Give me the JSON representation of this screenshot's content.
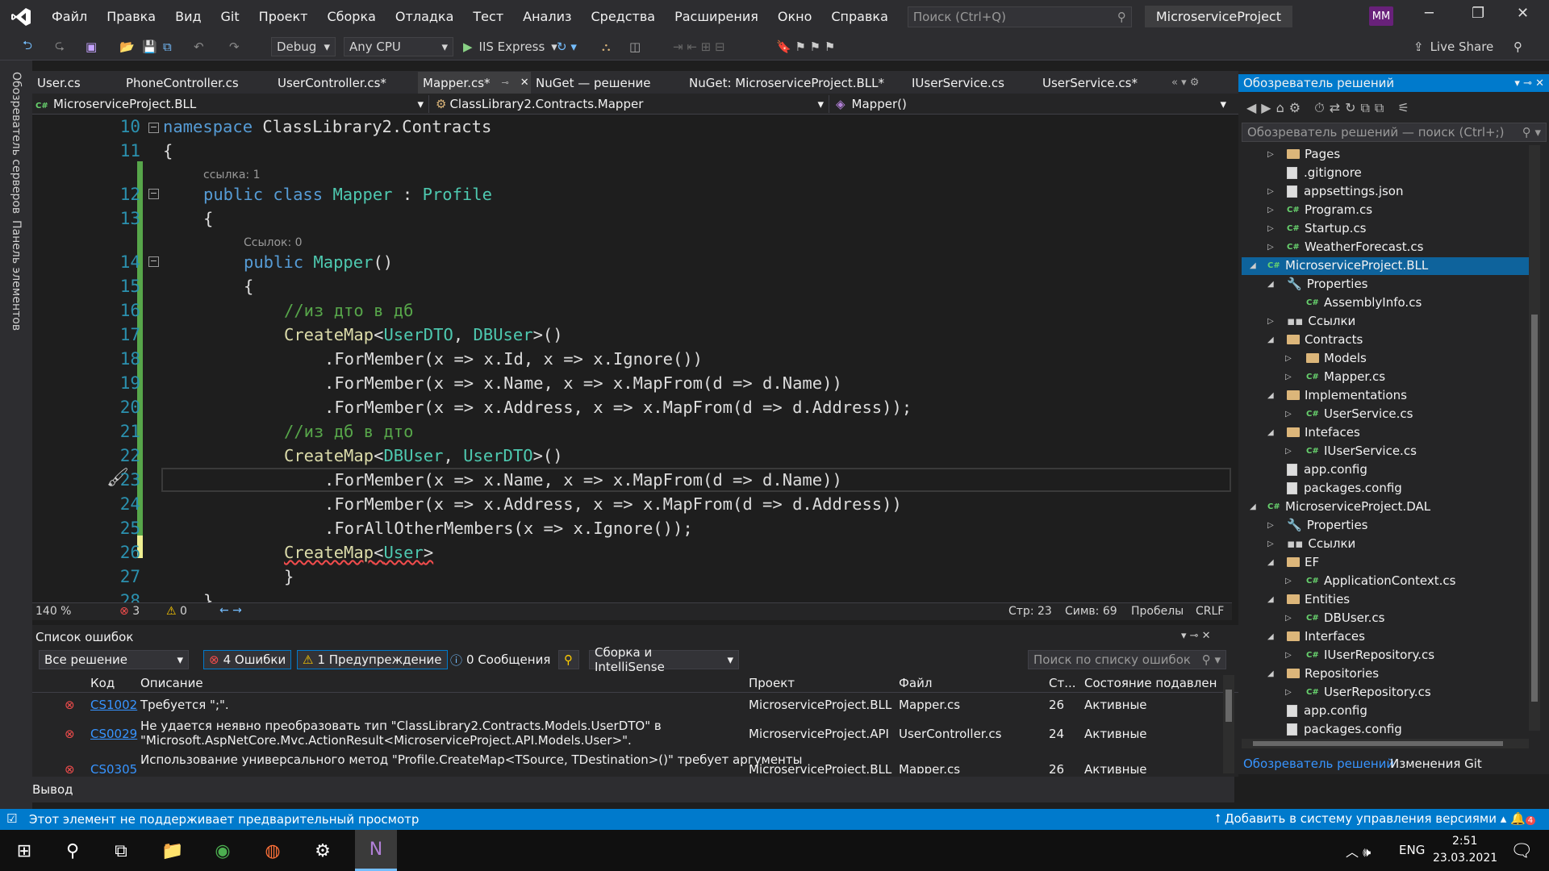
{
  "menubar": {
    "items": [
      "Файл",
      "Правка",
      "Вид",
      "Git",
      "Проект",
      "Сборка",
      "Отладка",
      "Тест",
      "Анализ",
      "Средства",
      "Расширения",
      "Окно",
      "Справка"
    ],
    "search_placeholder": "Поиск (Ctrl+Q)",
    "project": "MicroserviceProject",
    "avatar": "MM"
  },
  "toolbar": {
    "config": "Debug",
    "platform": "Any CPU",
    "run": "IIS Express",
    "live_share": "Live Share"
  },
  "leftstrip": {
    "servers": "Обозреватель серверов",
    "toolbox": "Панель элементов"
  },
  "tabs": [
    "User.cs",
    "PhoneController.cs",
    "UserController.cs*",
    "Mapper.cs*",
    "NuGet — решение",
    "NuGet: MicroserviceProject.BLL*",
    "IUserService.cs",
    "UserService.cs*"
  ],
  "navbar": {
    "project": "MicroserviceProject.BLL",
    "class": "ClassLibrary2.Contracts.Mapper",
    "member": "Mapper()"
  },
  "code": {
    "l10": {
      "n": "10",
      "kw": "namespace",
      "rest": " ClassLibrary2.Contracts"
    },
    "l11": {
      "n": "11",
      "t": "{"
    },
    "ref1": "ссылка: 1",
    "l12": {
      "n": "12",
      "a": "public",
      "b": "class",
      "c": "Mapper",
      "d": " : ",
      "e": "Profile"
    },
    "l13": {
      "n": "13",
      "t": "{"
    },
    "ref2": "Ссылок: 0",
    "l14": {
      "n": "14",
      "a": "public",
      "c": "Mapper",
      "d": "()"
    },
    "l15": {
      "n": "15",
      "t": "{"
    },
    "l16": {
      "n": "16",
      "t": "//из дто в дб"
    },
    "l17": {
      "n": "17",
      "m": "CreateMap",
      "a": "<",
      "b": "UserDTO",
      ",": ", ",
      "c": "DBUser",
      "d": ">()"
    },
    "l18": {
      "n": "18",
      "t": ".ForMember(x => x.Id, x => x.Ignore())"
    },
    "l19": {
      "n": "19",
      "t": ".ForMember(x => x.Name, x => x.MapFrom(d => d.Name))"
    },
    "l20": {
      "n": "20",
      "t": ".ForMember(x => x.Address, x => x.MapFrom(d => d.Address));"
    },
    "l21": {
      "n": "21",
      "t": "//из дб в дто"
    },
    "l22": {
      "n": "22",
      "m": "CreateMap",
      "a": "<",
      "b": "DBUser",
      "sep": ", ",
      "c": "UserDTO",
      "d": ">()"
    },
    "l23": {
      "n": "23",
      "t": ".ForMember(x => x.Name, x => x.MapFrom(d => d.Name))"
    },
    "l24": {
      "n": "24",
      "t": ".ForMember(x => x.Address, x => x.MapFrom(d => d.Address))"
    },
    "l25": {
      "n": "25",
      "t": ".ForAllOtherMembers(x => x.Ignore());"
    },
    "l26": {
      "n": "26",
      "m": "CreateMap",
      "a": "<",
      "b": "User",
      "d": ">"
    },
    "l27": {
      "n": "27",
      "t": "}"
    },
    "l28": {
      "n": "28",
      "t": "}"
    }
  },
  "edstatus": {
    "zoom": "140 %",
    "errors": "3",
    "warnings": "0",
    "line": "Стр: 23",
    "col": "Симв: 69",
    "spaces": "Пробелы",
    "eol": "CRLF"
  },
  "errlist": {
    "title": "Список ошибок",
    "scope": "Все решение",
    "errors": "4 Ошибки",
    "warnings": "1 Предупреждение",
    "messages": "0 Сообщения",
    "build": "Сборка и IntelliSense",
    "search": "Поиск по списку ошибок",
    "headers": [
      "Код",
      "Описание",
      "Проект",
      "Файл",
      "Ст...",
      "Состояние подавлен"
    ],
    "rows": [
      {
        "code": "CS1002",
        "desc": "Требуется \";\".",
        "proj": "MicroserviceProject.BLL",
        "file": "Mapper.cs",
        "line": "26",
        "state": "Активные"
      },
      {
        "code": "CS0029",
        "desc": "Не удается неявно преобразовать тип \"ClassLibrary2.Contracts.Models.UserDTO\" в",
        "desc2": "\"Microsoft.AspNetCore.Mvc.ActionResult<MicroserviceProject.API.Models.User>\".",
        "proj": "MicroserviceProject.API",
        "file": "UserController.cs",
        "line": "24",
        "state": "Активные"
      },
      {
        "code": "CS0305",
        "desc": "Использование универсального метод \"Profile.CreateMap<TSource, TDestination>()\" требует аргументы",
        "proj": "MicroserviceProject.BLL",
        "file": "Mapper.cs",
        "line": "26",
        "state": "Активные"
      }
    ]
  },
  "output": "Вывод",
  "solution": {
    "title": "Обозреватель решений",
    "search": "Обозреватель решений — поиск (Ctrl+;)",
    "items": [
      "Pages",
      ".gitignore",
      "appsettings.json",
      "Program.cs",
      "Startup.cs",
      "WeatherForecast.cs",
      "MicroserviceProject.BLL",
      "Properties",
      "AssemblyInfo.cs",
      "Ссылки",
      "Contracts",
      "Models",
      "Mapper.cs",
      "Implementations",
      "UserService.cs",
      "Intefaces",
      "IUserService.cs",
      "app.config",
      "packages.config",
      "MicroserviceProject.DAL",
      "Properties",
      "Ссылки",
      "EF",
      "ApplicationContext.cs",
      "Entities",
      "DBUser.cs",
      "Interfaces",
      "IUserRepository.cs",
      "Repositories",
      "UserRepository.cs",
      "app.config",
      "packages.config"
    ],
    "tab1": "Обозреватель решений",
    "tab2": "Изменения Git"
  },
  "statusbar": {
    "left": "Этот элемент не поддерживает предварительный просмотр",
    "right": "Добавить в систему управления версиями",
    "notif": "4"
  },
  "taskbar": {
    "lang": "ENG",
    "time": "2:51",
    "date": "23.03.2021"
  }
}
